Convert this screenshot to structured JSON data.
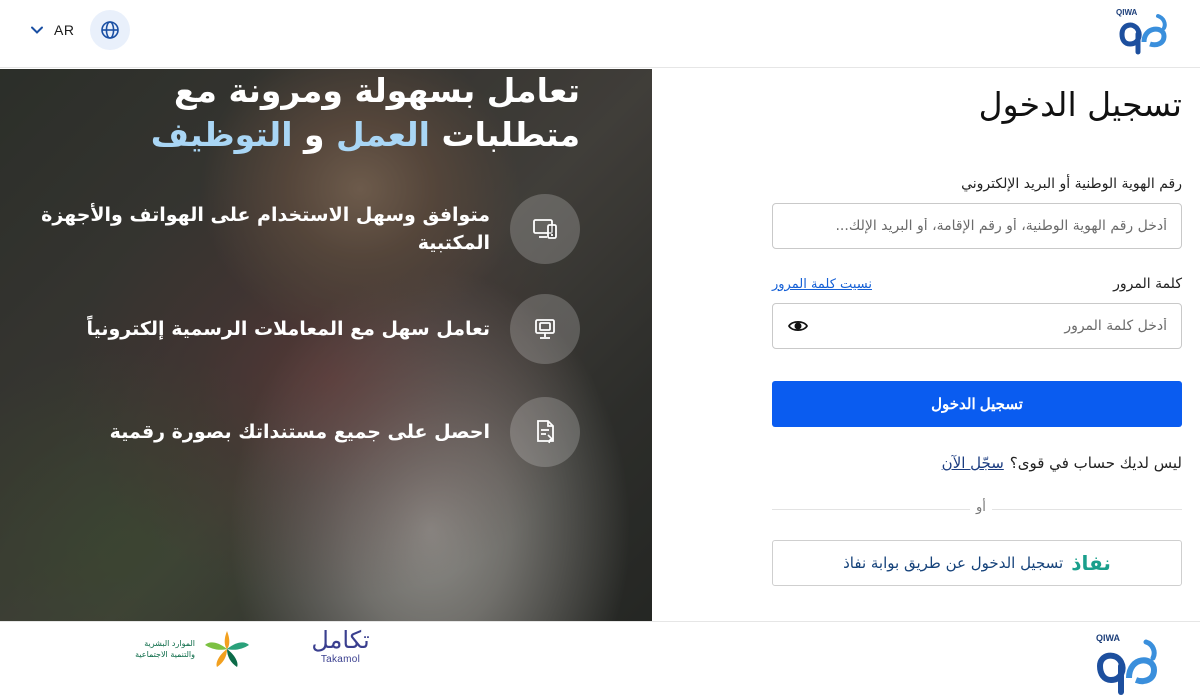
{
  "header": {
    "lang_code": "AR",
    "brand": "QIWA"
  },
  "hero": {
    "title_line1": "تعامل بسهولة ومرونة مع",
    "title_line2_start": "متطلبات",
    "title_accent1": "العمل",
    "title_mid": "و",
    "title_accent2": "التوظيف",
    "features": [
      {
        "text": "متوافق وسهل الاستخدام على الهواتف والأجهزة المكتبية",
        "icon": "devices-icon"
      },
      {
        "text": "تعامل سهل مع المعاملات الرسمية إلكترونياً",
        "icon": "desktop-icon"
      },
      {
        "text": "احصل على جميع مستنداتك بصورة رقمية",
        "icon": "document-icon"
      }
    ],
    "accent_color": "#a9d6f5"
  },
  "form": {
    "title": "تسجيل الدخول",
    "id_label": "رقم الهوية الوطنية أو البريد الإلكتروني",
    "id_placeholder": "أدخل رقم الهوية الوطنية، أو رقم الإقامة، أو البريد الإلك...",
    "id_value": "",
    "password_label": "كلمة المرور",
    "forgot_password": "نسيت كلمة المرور",
    "password_placeholder": "أدخل كلمة المرور",
    "password_value": "",
    "submit_label": "تسجيل الدخول",
    "no_account_text": "ليس لديك حساب في قوى؟",
    "register_label": "سجّل الآن",
    "or_text": "أو",
    "nafath_logo": "نفاذ",
    "nafath_label": "تسجيل الدخول عن طريق بوابة نفاذ",
    "primary_color": "#0a5cf0"
  },
  "footer": {
    "hrsd_line1": "الموارد البشرية",
    "hrsd_line2": "والتنمية الاجتماعية",
    "takamol_ar": "تكامل",
    "takamol_en": "Takamol",
    "brand": "QIWA"
  }
}
